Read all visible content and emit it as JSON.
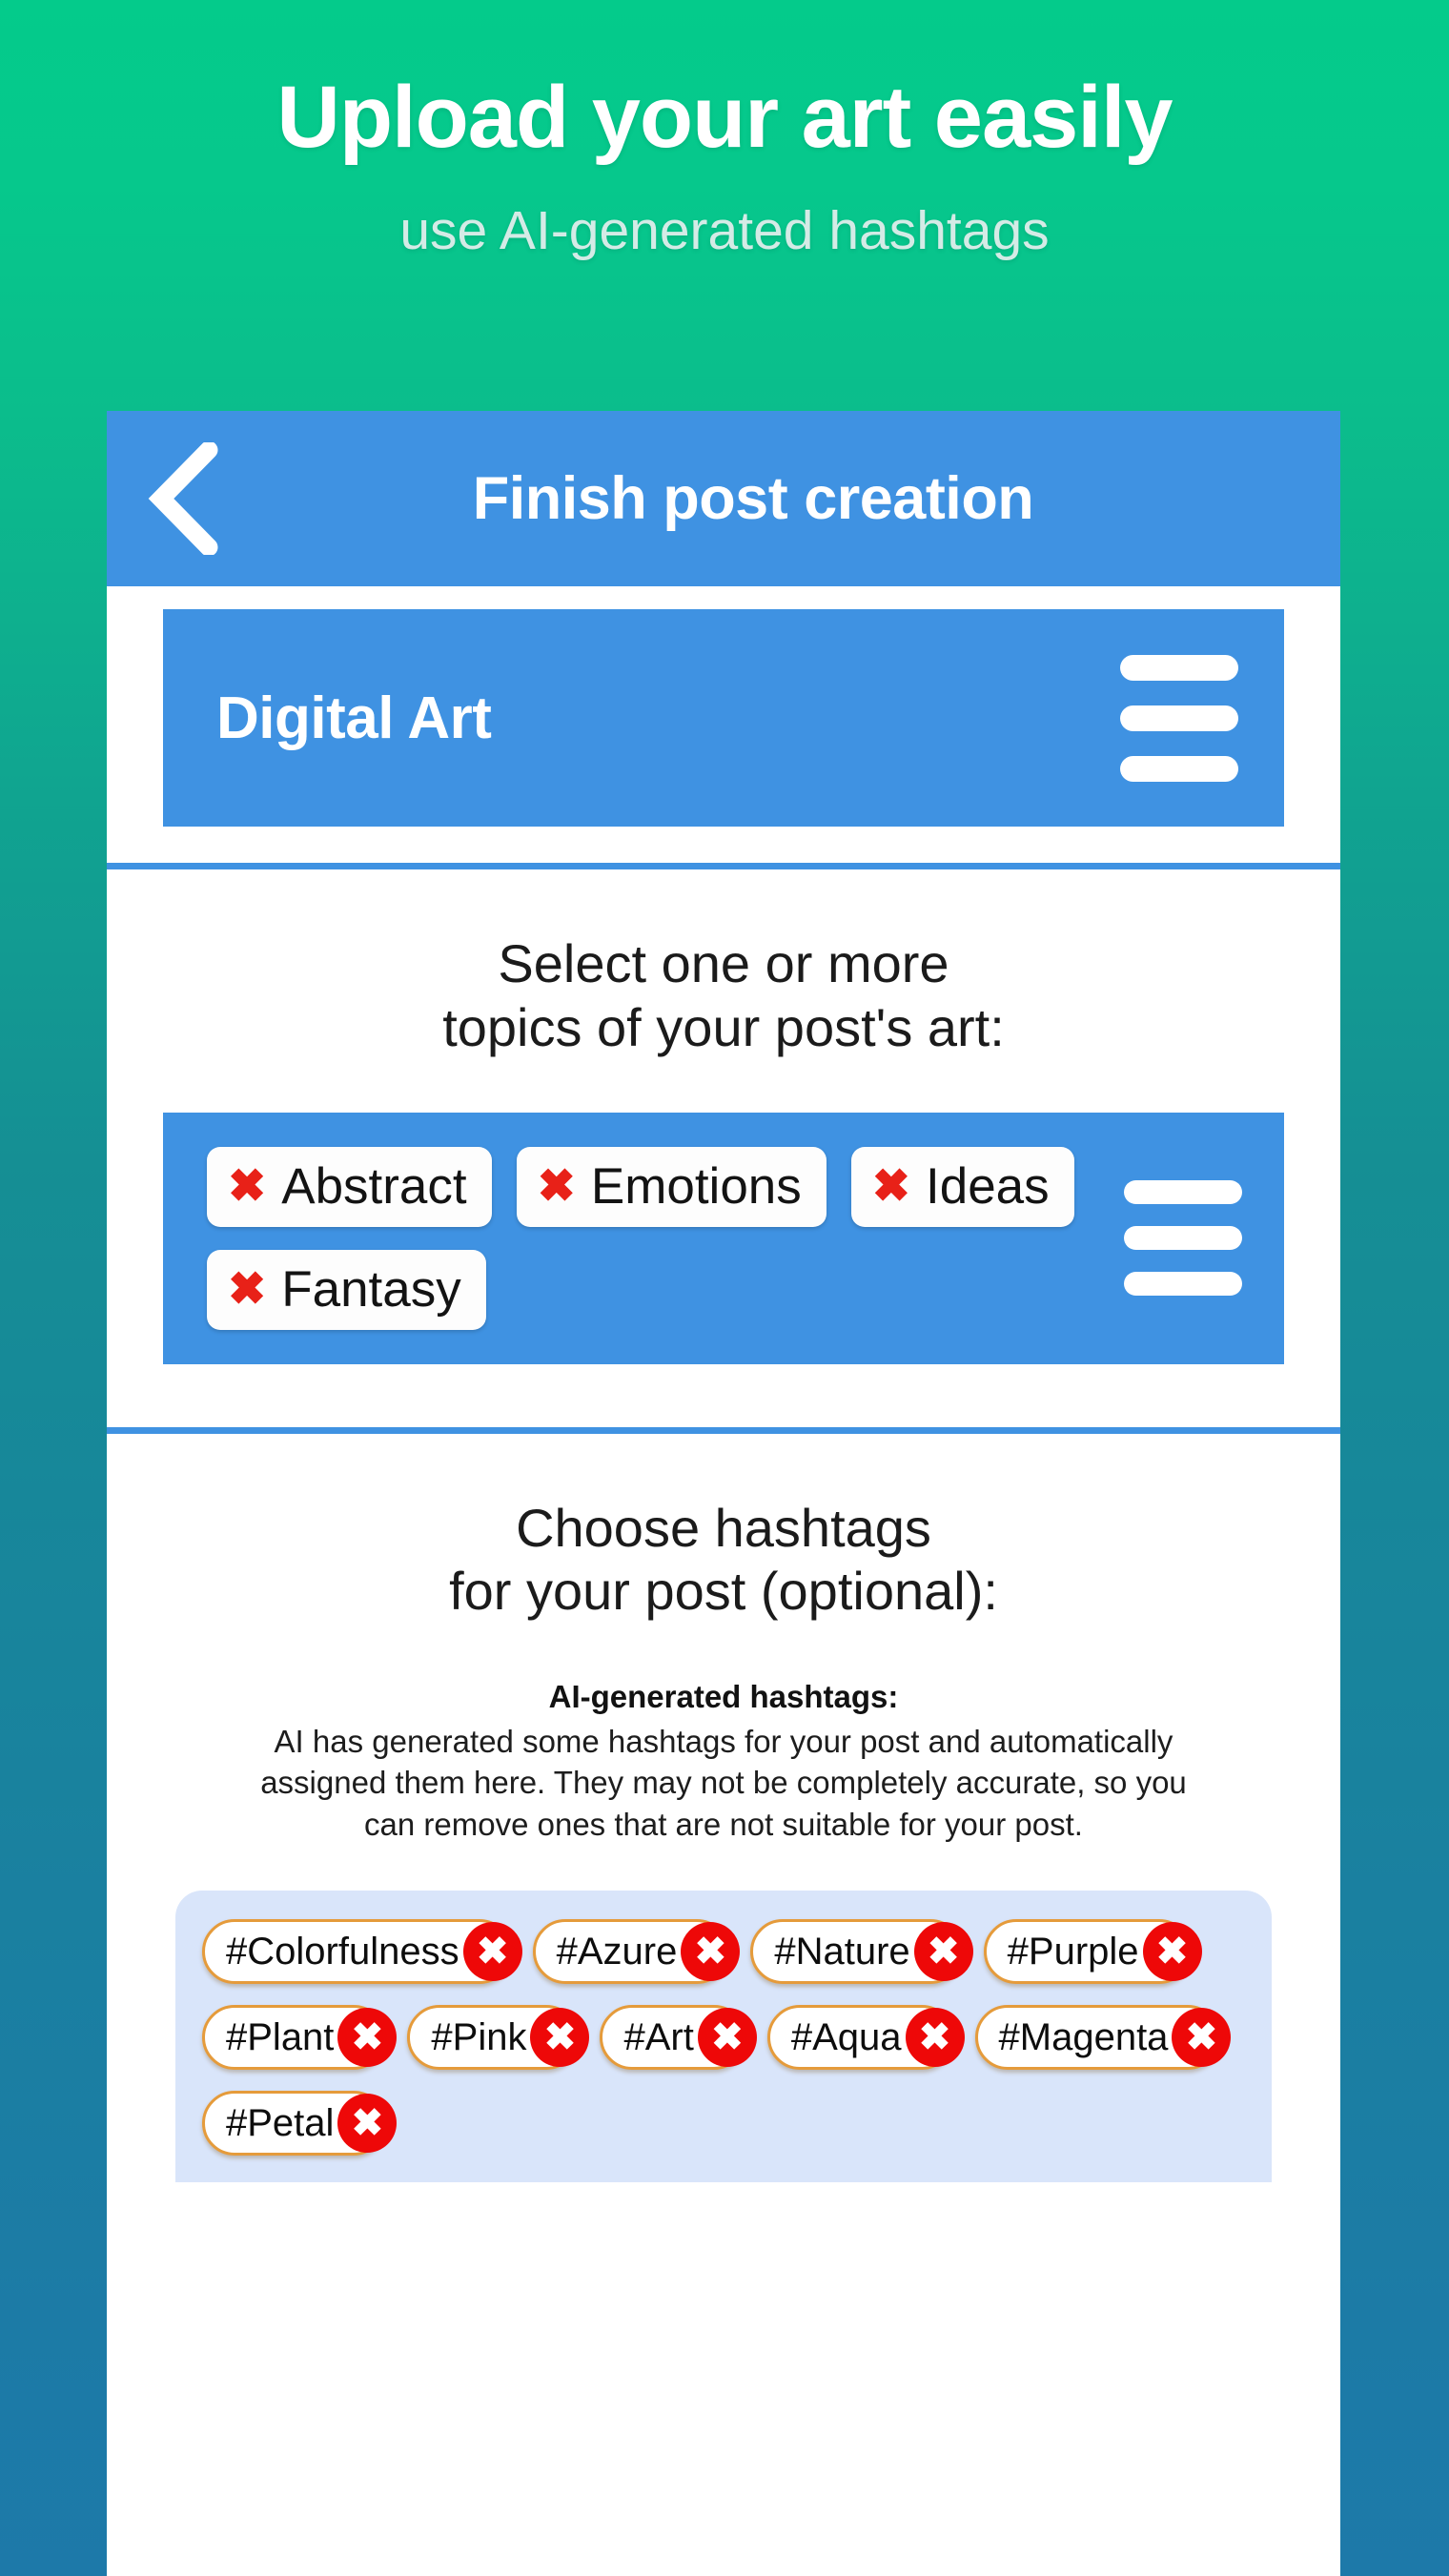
{
  "promo": {
    "title": "Upload your art easily",
    "subtitle": "use AI-generated hashtags"
  },
  "colors": {
    "bg_gradient_top": "#04cb8b",
    "bg_gradient_bottom": "#1d79a9",
    "accent_blue": "#3f92e2",
    "hashtag_panel_bg": "#d9e5fa",
    "hashtag_border": "#e59b3b",
    "remove_red": "#ee0808",
    "topic_x_red": "#e82118"
  },
  "appbar": {
    "back_icon": "chevron-left-icon",
    "title": "Finish post creation"
  },
  "title_field": {
    "value": "Digital Art",
    "menu_icon": "hamburger-menu-icon"
  },
  "topics_section": {
    "heading_line1": "Select one or more",
    "heading_line2": "topics of your post's art:",
    "menu_icon": "hamburger-menu-icon",
    "chips": [
      {
        "remove_icon": "✖",
        "label": "Abstract"
      },
      {
        "remove_icon": "✖",
        "label": "Emotions"
      },
      {
        "remove_icon": "✖",
        "label": "Ideas"
      },
      {
        "remove_icon": "✖",
        "label": "Fantasy"
      }
    ]
  },
  "hashtags_section": {
    "heading_line1": "Choose hashtags",
    "heading_line2": "for your post (optional):",
    "ai_note_title": "AI-generated hashtags:",
    "ai_note_body": "AI has generated some hashtags for your post and automatically assigned them here. They may not be completely accurate, so you can remove ones that are not suitable for your post.",
    "remove_icon": "✖",
    "chips": [
      {
        "label": "#Colorfulness"
      },
      {
        "label": "#Azure"
      },
      {
        "label": "#Nature"
      },
      {
        "label": "#Purple"
      },
      {
        "label": "#Plant"
      },
      {
        "label": "#Pink"
      },
      {
        "label": "#Art"
      },
      {
        "label": "#Aqua"
      },
      {
        "label": "#Magenta"
      },
      {
        "label": "#Petal"
      }
    ]
  }
}
